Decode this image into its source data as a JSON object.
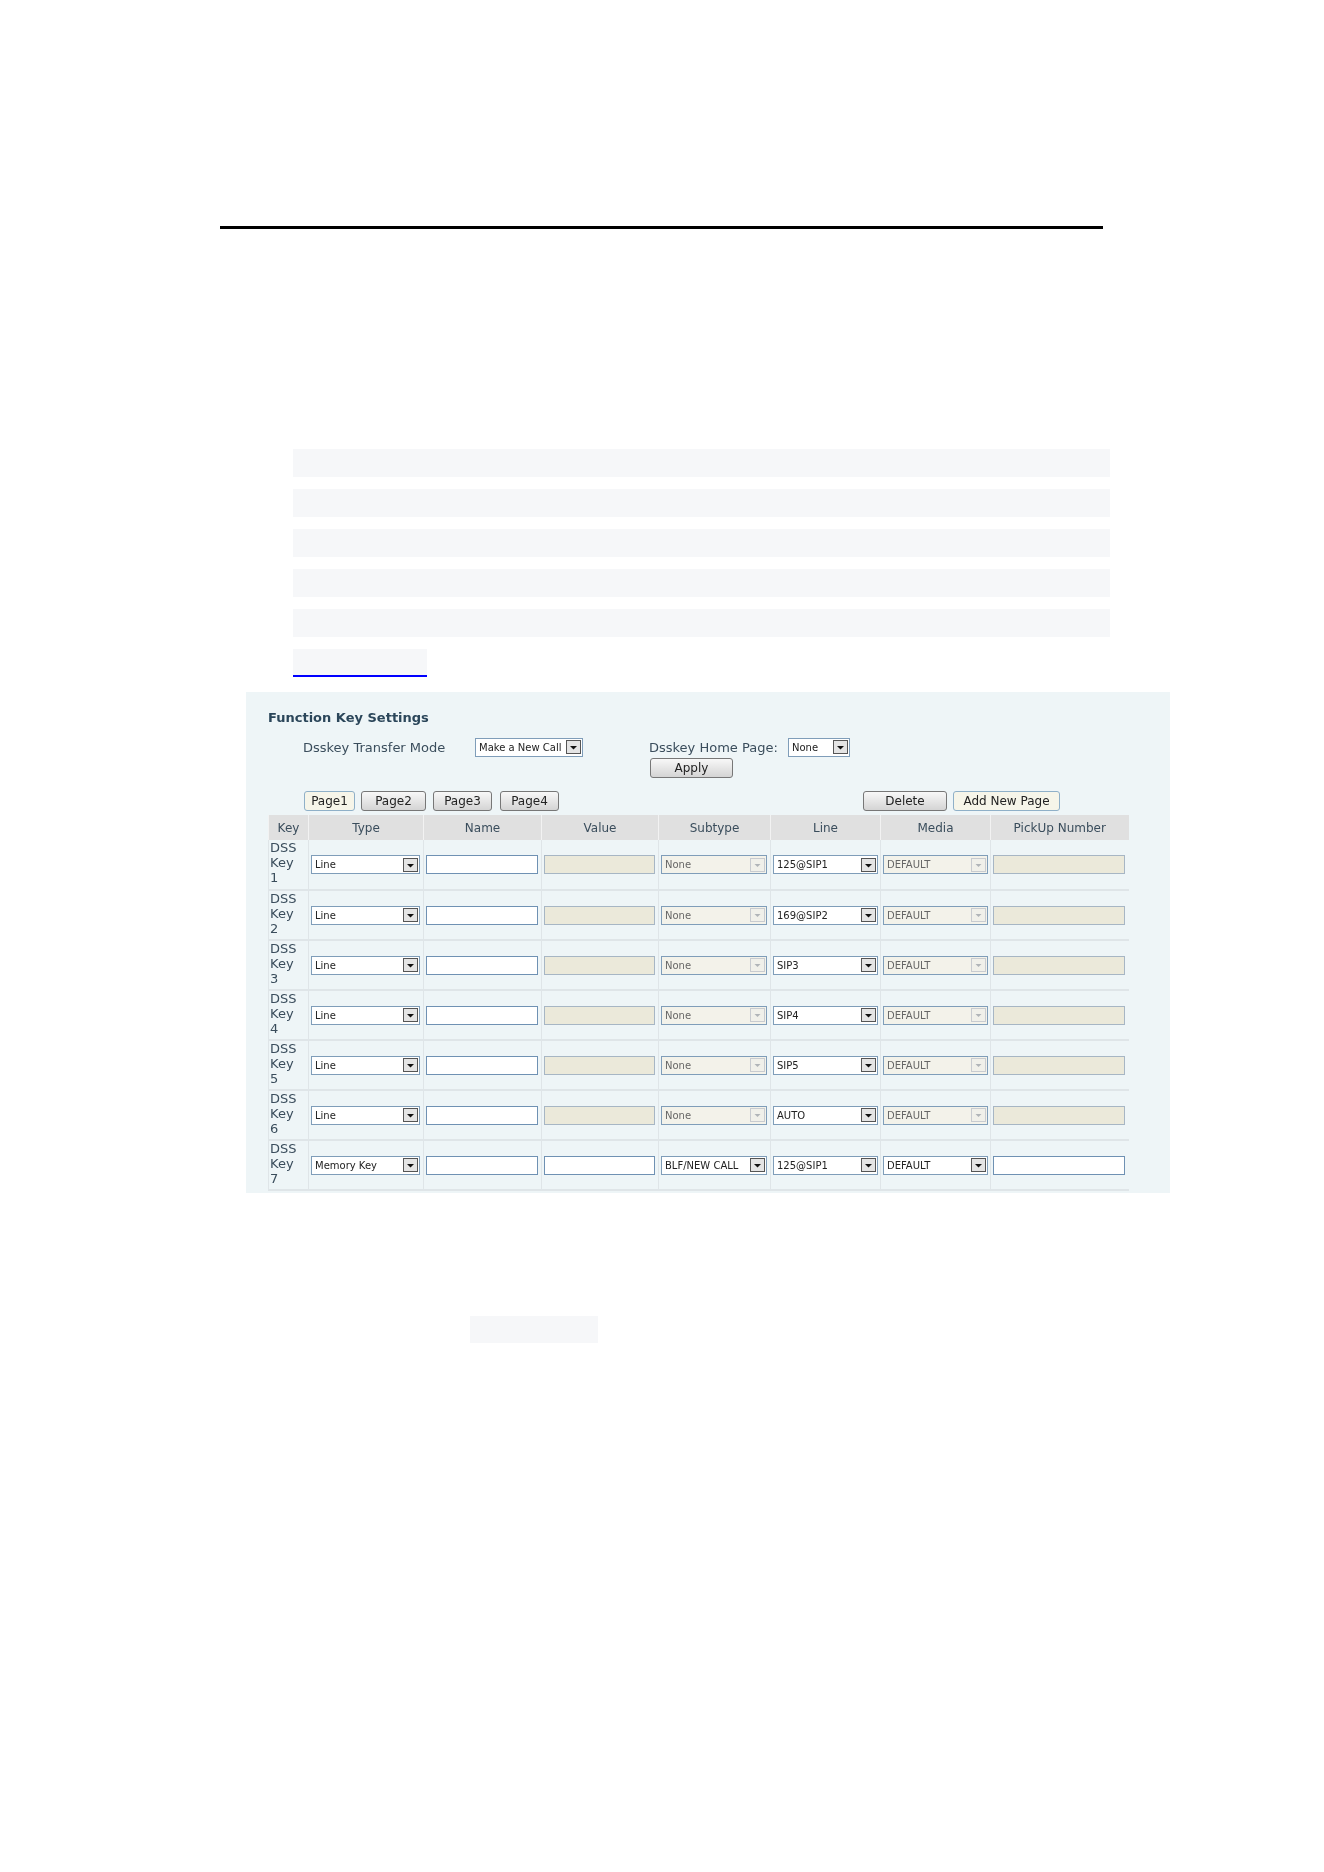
{
  "panel": {
    "title": "Function Key Settings",
    "transfer_mode": {
      "label": "Dsskey Transfer Mode",
      "value": "Make a New Call"
    },
    "home_page": {
      "label": "Dsskey Home Page:",
      "value": "None"
    },
    "apply": "Apply",
    "pages": [
      {
        "label": "Page1",
        "selected": true
      },
      {
        "label": "Page2",
        "selected": false
      },
      {
        "label": "Page3",
        "selected": false
      },
      {
        "label": "Page4",
        "selected": false
      }
    ],
    "actions": [
      {
        "label": "Delete",
        "kind": "raised"
      },
      {
        "label": "Add New Page",
        "kind": "flat"
      }
    ],
    "columns": [
      "Key",
      "Type",
      "Name",
      "Value",
      "Subtype",
      "Line",
      "Media",
      "PickUp Number"
    ],
    "rows": [
      {
        "key": "DSS Key 1",
        "type": "Line",
        "subtype": "None",
        "line": "125@SIP1",
        "media": "DEFAULT",
        "fields_disabled": true
      },
      {
        "key": "DSS Key 2",
        "type": "Line",
        "subtype": "None",
        "line": "169@SIP2",
        "media": "DEFAULT",
        "fields_disabled": true
      },
      {
        "key": "DSS Key 3",
        "type": "Line",
        "subtype": "None",
        "line": "SIP3",
        "media": "DEFAULT",
        "fields_disabled": true
      },
      {
        "key": "DSS Key 4",
        "type": "Line",
        "subtype": "None",
        "line": "SIP4",
        "media": "DEFAULT",
        "fields_disabled": true
      },
      {
        "key": "DSS Key 5",
        "type": "Line",
        "subtype": "None",
        "line": "SIP5",
        "media": "DEFAULT",
        "fields_disabled": true
      },
      {
        "key": "DSS Key 6",
        "type": "Line",
        "subtype": "None",
        "line": "AUTO",
        "media": "DEFAULT",
        "fields_disabled": true
      },
      {
        "key": "DSS Key 7",
        "type": "Memory Key",
        "subtype": "BLF/NEW CALL",
        "line": "125@SIP1",
        "media": "DEFAULT",
        "fields_disabled": false
      }
    ]
  }
}
